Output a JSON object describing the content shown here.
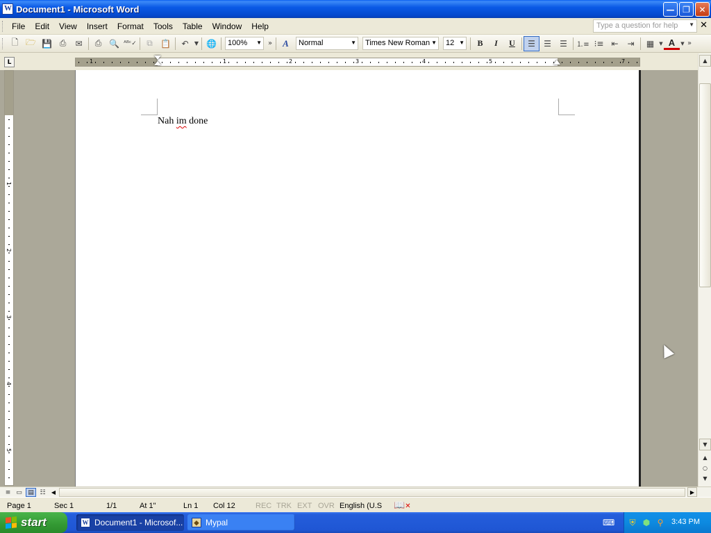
{
  "window": {
    "title": "Document1 - Microsoft Word",
    "minimize": "—",
    "restore": "❐",
    "close": "✕"
  },
  "menu": {
    "items": [
      "File",
      "Edit",
      "View",
      "Insert",
      "Format",
      "Tools",
      "Table",
      "Window",
      "Help"
    ],
    "help_placeholder": "Type a question for help"
  },
  "toolbar": {
    "zoom": "100%",
    "style": "Normal",
    "font": "Times New Roman",
    "size": "12",
    "bold": "B",
    "italic": "I",
    "underline": "U",
    "alignment_active": "left"
  },
  "ruler": {
    "h_numbers": [
      "1",
      "1",
      "2",
      "3",
      "4",
      "5",
      "7"
    ],
    "v_numbers": [
      "1",
      "2",
      "3",
      "4",
      "5"
    ]
  },
  "document": {
    "text_part1": "Nah ",
    "text_misspelled": "im",
    "text_part2": " done"
  },
  "statusbar": {
    "page": "Page  1",
    "section": "Sec  1",
    "pages": "1/1",
    "at": "At  1\"",
    "line": "Ln  1",
    "col": "Col  12",
    "rec": "REC",
    "trk": "TRK",
    "ext": "EXT",
    "ovr": "OVR",
    "language": "English (U.S"
  },
  "taskbar": {
    "start": "start",
    "tasks": [
      {
        "label": "Document1 - Microsof...",
        "active": true
      },
      {
        "label": "Mypal",
        "active": false
      }
    ],
    "clock": "3:43 PM"
  },
  "colors": {
    "titlebar": "#0a5ae6",
    "taskbar": "#245edb",
    "start": "#339933",
    "font_color": "#d00000"
  }
}
